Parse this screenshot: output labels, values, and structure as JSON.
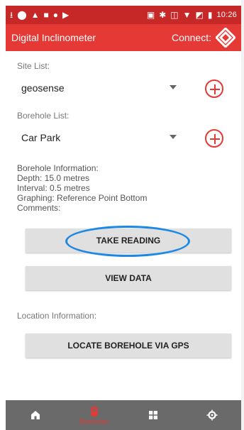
{
  "statusBar": {
    "time": "10:26",
    "leftIcons": [
      "usb-icon",
      "notification-icon",
      "warning-icon",
      "image-icon",
      "circle-icon",
      "play-icon"
    ],
    "rightIcons": [
      "nfc-icon",
      "bluetooth-icon",
      "vibrate-icon",
      "wifi-icon",
      "no-signal-icon",
      "battery-icon"
    ]
  },
  "appBar": {
    "title": "Digital Inclinometer",
    "connectLabel": "Connect:"
  },
  "site": {
    "label": "Site List:",
    "value": "geosense"
  },
  "borehole": {
    "label": "Borehole List:",
    "value": "Car Park"
  },
  "boreholeInfo": {
    "heading": "Borehole Information:",
    "depth": "Depth: 15.0 metres",
    "interval": "Interval: 0.5 metres",
    "graphing": "Graphing: Reference Point Bottom",
    "comments": "Comments:"
  },
  "buttons": {
    "takeReading": "TAKE READING",
    "viewData": "VIEW DATA",
    "locate": "LOCATE BOREHOLE VIA GPS"
  },
  "locationInfo": {
    "label": "Location Information:"
  },
  "bottomNav": {
    "items": [
      {
        "icon": "home-icon",
        "label": ""
      },
      {
        "icon": "borehole-icon",
        "label": "Boreholes"
      },
      {
        "icon": "dashboard-icon",
        "label": ""
      },
      {
        "icon": "settings-icon",
        "label": ""
      }
    ]
  },
  "colors": {
    "primary": "#e53935",
    "statusBar": "#c62828",
    "highlight": "#1e88e5",
    "bottomNav": "#6a6a6a"
  }
}
